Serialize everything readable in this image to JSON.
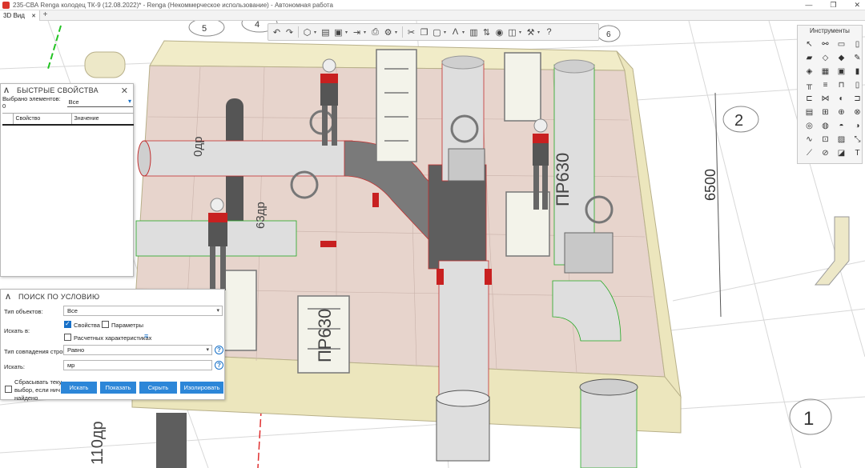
{
  "window": {
    "title": "235-СВА Renga колодец ТК-9 (12.08.2022)* - Renga (Некоммерческое использование) - Автономная работа",
    "minimize": "—",
    "maximize": "❐",
    "close": "✕"
  },
  "tabs": [
    {
      "label": "3D Вид",
      "close": "✕"
    }
  ],
  "tab_add": "+",
  "instruments_panel": {
    "title": "Инструменты"
  },
  "quick_props": {
    "title": "БЫСТРЫЕ СВОЙСТВА",
    "close": "✕",
    "selected_label": "Выбрано элементов: 0",
    "selected_value": "Все",
    "col_property": "Свойство",
    "col_value": "Значение"
  },
  "search_panel": {
    "title": "ПОИСК ПО УСЛОВИЮ",
    "object_type_label": "Тип объектов:",
    "object_type_value": "Все",
    "search_in_label": "Искать в:",
    "cb_properties": "Свойства",
    "cb_parameters": "Параметры",
    "cb_calculated": "Расчетных характеристиках",
    "match_type_label": "Тип совпадения строк:",
    "match_type_value": "Равно",
    "search_label": "Искать:",
    "search_value": "мр",
    "reset_label_1": "Сбрасывать теку",
    "reset_label_2": "выбор, если нич",
    "reset_label_3": "найдено",
    "btn_search": "Искать",
    "btn_show": "Показать",
    "btn_hide": "Скрыть",
    "btn_isolate": "Изолировать",
    "help": "?"
  },
  "scene_labels": {
    "pr630_right": "ПР630",
    "pr630_left": "ПР630",
    "dim_6500": "6500",
    "grid_2": "2",
    "grid_1": "1",
    "pipe_odr": "0др",
    "pipe_63dr": "63др",
    "pipe_110dr": "110др",
    "bubble_top_1": "5",
    "bubble_top_2": "4",
    "bubble_top_3": "6"
  },
  "colors": {
    "accent": "#2c86d8",
    "brand_red": "#d9342b",
    "box_wall": "#ece6bd",
    "floor": "#e3cfc8",
    "pipe_light": "#dedede",
    "pipe_dark": "#666666"
  }
}
